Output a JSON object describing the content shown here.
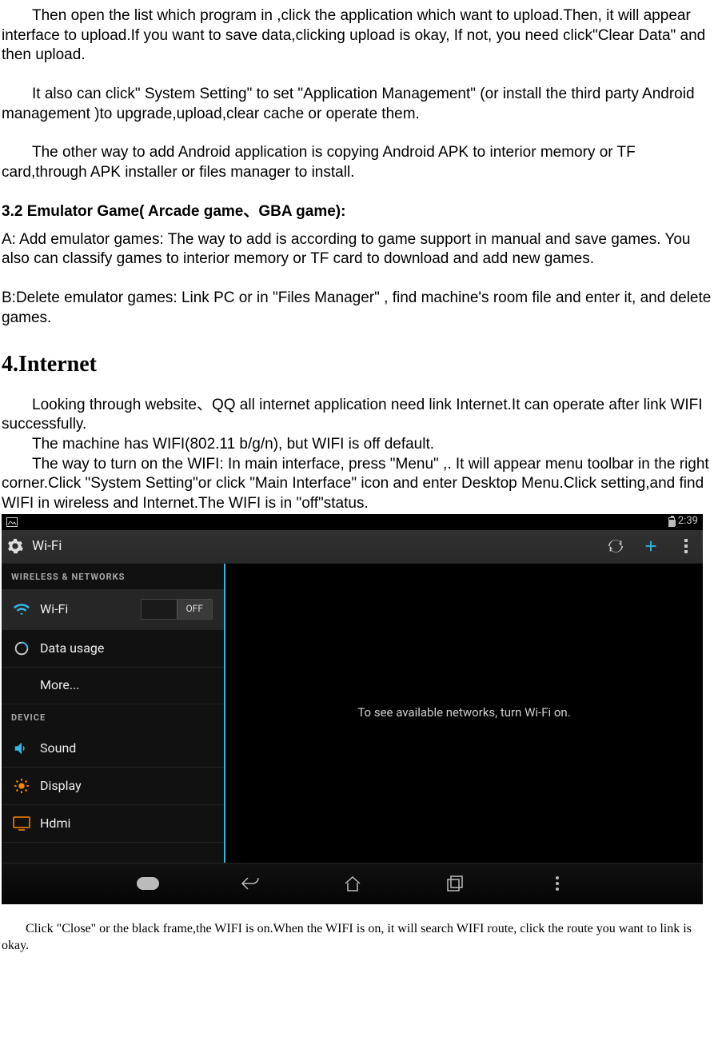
{
  "doc": {
    "p1": "Then open the list which program in ,click the application which want to upload.Then, it will appear interface to upload.If you want to save data,clicking upload is okay, If not, you need click\"Clear Data\" and then upload.",
    "p2": "It also can click\" System Setting\" to set \"Application Management\"   (or install the third party Android management )to upgrade,upload,clear cache or operate them.",
    "p3": "The other way to add Android application is copying Android APK to interior memory or TF card,through APK installer or files manager to install.",
    "h32": "3.2 Emulator Game( Arcade game、GBA game):",
    "p4": "A: Add emulator games: The way to add is according to game support in manual and save games. You also can classify games to interior memory or TF card to download and add new games.",
    "p5": "B:Delete emulator games: Link PC or in \"Files Manager\" , find machine's room file and enter it, and delete games.",
    "h4": "4.Internet",
    "p6": "Looking   through website、QQ all internet application need link Internet.It can operate after link WIFI successfully.",
    "p7": "The machine has WIFI(802.11 b/g/n), but WIFI is off default.",
    "p8": "The way to turn on the WIFI: In main interface, press \"Menu\" ,. It will appear menu toolbar in the right corner.Click \"System Setting\"or click \"Main Interface\" icon and enter Desktop Menu.Click setting,and find WIFI in wireless and Internet.The WIFI is in \"off\"status.",
    "p9": "Click \"Close\" or the black frame,the WIFI is on.When the WIFI is on, it will search WIFI route, click the route you want to link is okay."
  },
  "shot": {
    "clock": "2:39",
    "appTitle": "Wi-Fi",
    "sections": {
      "wireless": "WIRELESS & NETWORKS",
      "device": "DEVICE"
    },
    "items": {
      "wifi": "Wi-Fi",
      "data": "Data usage",
      "more": "More...",
      "sound": "Sound",
      "display": "Display",
      "hdmi": "Hdmi"
    },
    "toggleOff": "OFF",
    "mainMsg": "To see available networks, turn Wi-Fi on."
  }
}
